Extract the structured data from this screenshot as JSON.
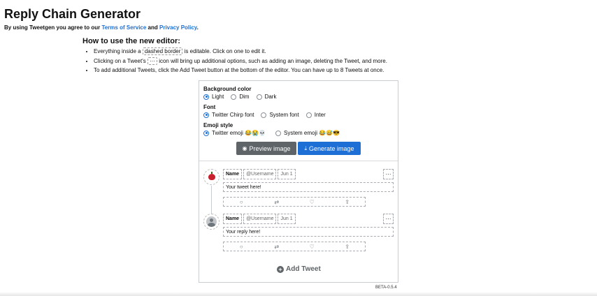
{
  "header": {
    "title": "Reply Chain Generator",
    "agree_prefix": "By using Tweetgen you agree to our ",
    "terms_link": "Terms of Service",
    "agree_and": " and ",
    "privacy_link": "Privacy Policy",
    "agree_suffix": "."
  },
  "howto": {
    "title": "How to use the new editor:",
    "line1_pre": "Everything inside a ",
    "line1_chip": "dashed border",
    "line1_post": " is editable. Click on one to edit it.",
    "line2_pre": "Clicking on a Tweet's ",
    "line2_chip": "···",
    "line2_post": " icon will bring up additional options, such as adding an image, deleting the Tweet, and more.",
    "line3": "To add additional Tweets, click the Add Tweet button at the bottom of the editor. You can have up to 8 Tweets at once."
  },
  "options": {
    "background": {
      "label": "Background color",
      "choices": [
        "Light",
        "Dim",
        "Dark"
      ],
      "selected": "Light"
    },
    "font": {
      "label": "Font",
      "choices": [
        "Twitter Chirp font",
        "System font",
        "Inter"
      ],
      "selected": "Twitter Chirp font"
    },
    "emoji": {
      "label": "Emoji style",
      "choices": [
        "Twitter emoji 😂😭💀",
        "System emoji 😂😅😎"
      ],
      "selected": "Twitter emoji 😂😭💀"
    }
  },
  "buttons": {
    "preview": "Preview image",
    "generate": "Generate image",
    "add_tweet": "Add Tweet"
  },
  "tweets": [
    {
      "name": "Name",
      "handle": "@Username",
      "date": "Jun 1",
      "text": "Your tweet here!",
      "avatar": "apple-avatar"
    },
    {
      "name": "Name",
      "handle": "@Username",
      "date": "Jun 1",
      "text": "Your reply here!",
      "avatar": "default-person-avatar"
    }
  ],
  "more_label": "···",
  "icons": {
    "reply": "○",
    "retweet": "⇄",
    "like": "♡",
    "share": "⇪",
    "eye": "👁",
    "download": "⤓"
  },
  "version": "BETA-0.5.4",
  "colors": {
    "link": "#1d6fd6",
    "primary": "#1d6fd6",
    "secondary": "#5f6468"
  }
}
